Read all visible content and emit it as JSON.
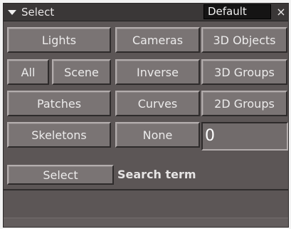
{
  "panel": {
    "title": "Select",
    "preset": "Default",
    "close_symbol": "×",
    "icons": {
      "collapse": "triangle-down-icon",
      "close": "close-icon"
    }
  },
  "buttons": {
    "lights": "Lights",
    "cameras": "Cameras",
    "objects_3d": "3D Objects",
    "all": "All",
    "scene": "Scene",
    "inverse": "Inverse",
    "groups_3d": "3D Groups",
    "patches": "Patches",
    "curves": "Curves",
    "groups_2d": "2D Groups",
    "skeletons": "Skeletons",
    "none": "None",
    "select": "Select"
  },
  "count_field": {
    "value": "0"
  },
  "search": {
    "label": "Search term"
  },
  "colors": {
    "panel_bg": "#5c5656",
    "button_bg": "#7a7474",
    "titlebar_bg": "#3a3737",
    "preset_bg": "#151414"
  }
}
